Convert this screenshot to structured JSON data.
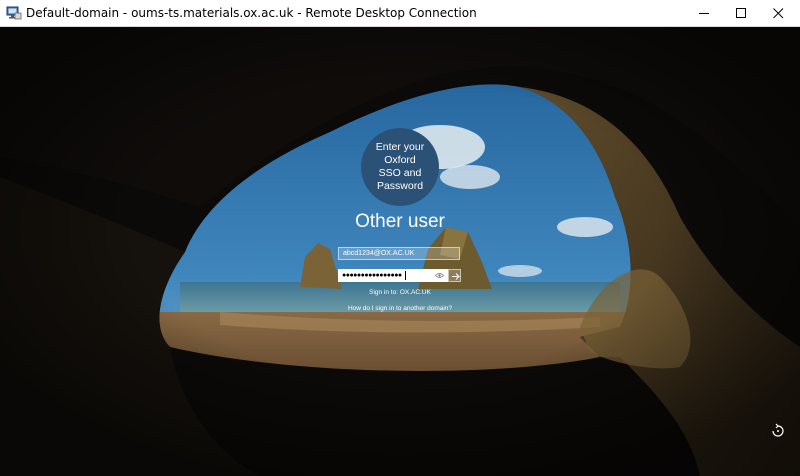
{
  "window": {
    "title": "Default-domain - oums-ts.materials.ox.ac.uk - Remote Desktop Connection",
    "icons": [
      "remote-desktop-icon",
      "minimize-icon",
      "maximize-icon",
      "close-icon"
    ]
  },
  "login": {
    "avatar_text": "Enter your\nOxford\nSSO and\nPassword",
    "user_heading": "Other user",
    "username_value": "abcd1234@OX.AC.UK",
    "password_value": "●●●●●●●●●●●●●●●●",
    "sign_in_to": "Sign in to: OX.AC.UK",
    "other_domain_link": "How do I sign in to another domain?",
    "avatar_color": "#2b5176"
  },
  "footer": {
    "ease_of_access_icon": "ease-of-access-icon"
  }
}
